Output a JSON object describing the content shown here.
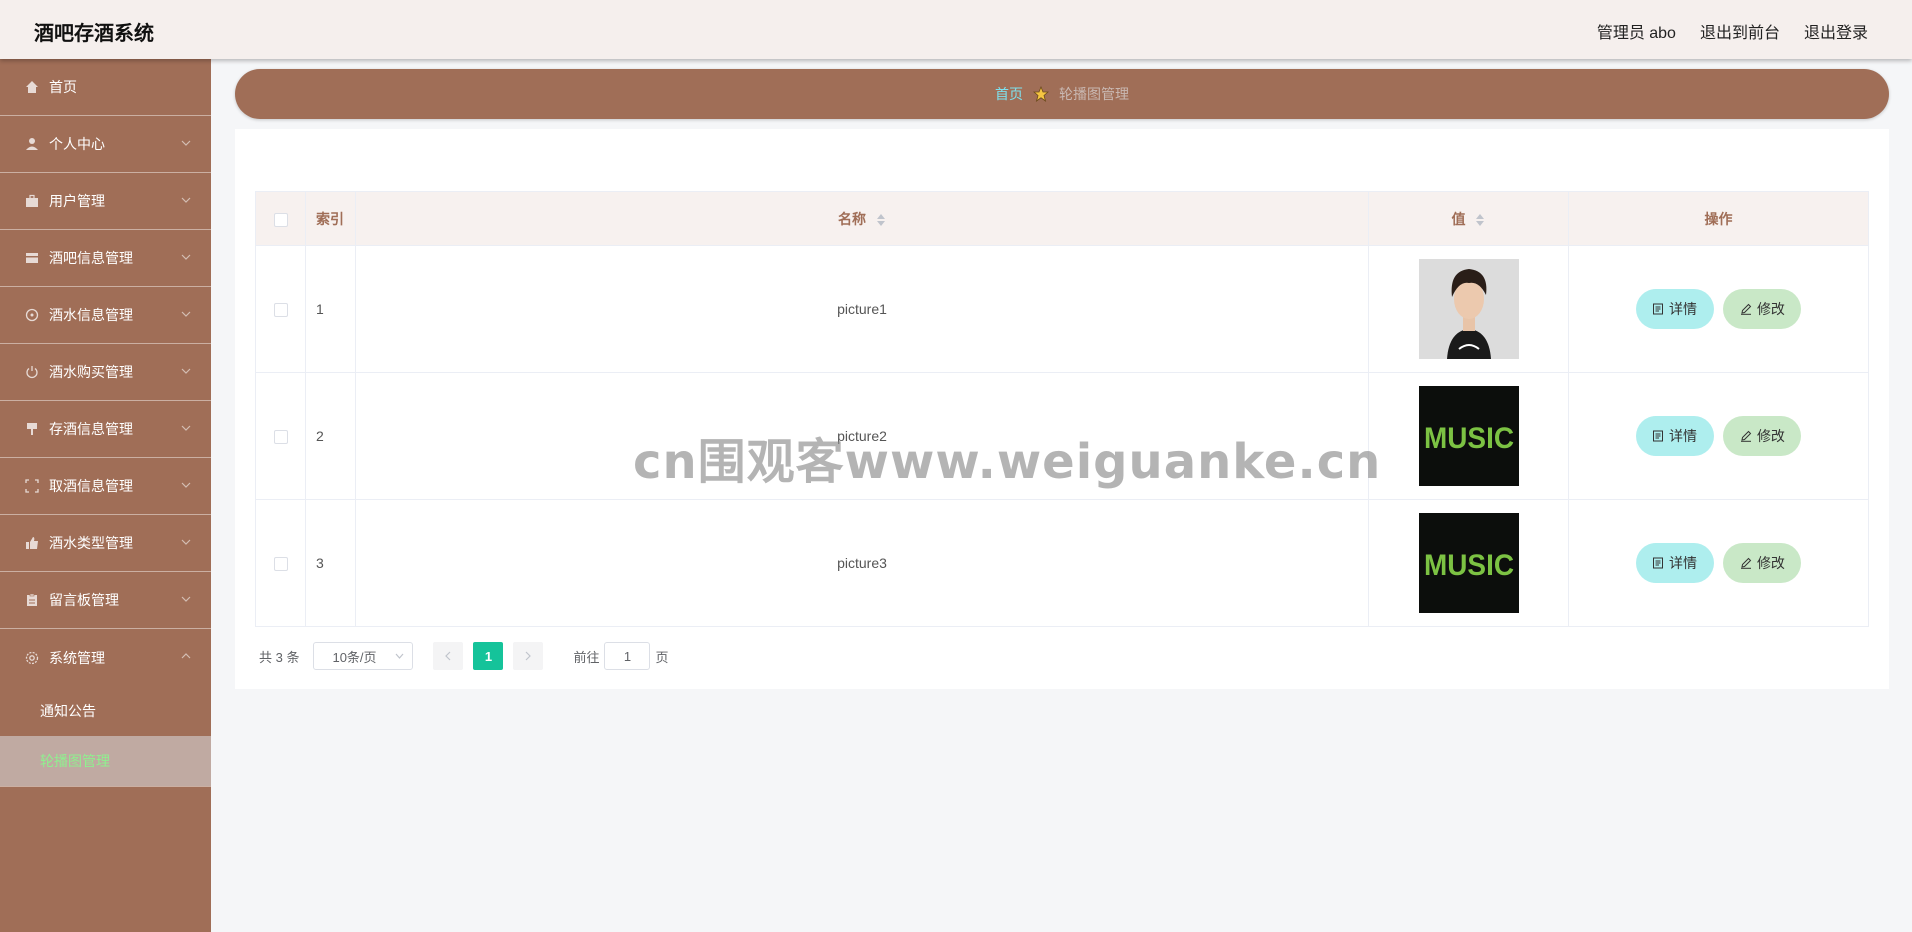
{
  "header": {
    "title": "酒吧存酒系统",
    "admin": "管理员 abo",
    "to_front": "退出到前台",
    "logout": "退出登录"
  },
  "sidebar": {
    "items": [
      {
        "label": "首页",
        "icon": "home-icon"
      },
      {
        "label": "个人中心",
        "icon": "user-icon"
      },
      {
        "label": "用户管理",
        "icon": "briefcase-icon"
      },
      {
        "label": "酒吧信息管理",
        "icon": "card-icon"
      },
      {
        "label": "酒水信息管理",
        "icon": "dial-icon"
      },
      {
        "label": "酒水购买管理",
        "icon": "power-icon"
      },
      {
        "label": "存酒信息管理",
        "icon": "brush-icon"
      },
      {
        "label": "取酒信息管理",
        "icon": "frame-icon"
      },
      {
        "label": "酒水类型管理",
        "icon": "thumb-icon"
      },
      {
        "label": "留言板管理",
        "icon": "clipboard-icon"
      },
      {
        "label": "系统管理",
        "icon": "gear-icon"
      }
    ],
    "sub_items": [
      {
        "label": "通知公告"
      },
      {
        "label": "轮播图管理"
      }
    ]
  },
  "breadcrumb": {
    "home": "首页",
    "current": "轮播图管理"
  },
  "table": {
    "headers": {
      "index": "索引",
      "name": "名称",
      "value": "值",
      "ops": "操作"
    },
    "rows": [
      {
        "index": "1",
        "name": "picture1",
        "image": "portrait"
      },
      {
        "index": "2",
        "name": "picture2",
        "image": "music"
      },
      {
        "index": "3",
        "name": "picture3",
        "image": "music"
      }
    ],
    "detail_label": "详情",
    "edit_label": "修改"
  },
  "pagination": {
    "total": "共 3 条",
    "page_size": "10条/页",
    "current_page": "1",
    "goto_prefix": "前往",
    "goto_value": "1",
    "goto_suffix": "页"
  },
  "colors": {
    "sidebar": "#a06e57",
    "header": "#f5efed",
    "accent": "#15c39a"
  },
  "watermark": "cn围观客www.weiguanke.cn"
}
